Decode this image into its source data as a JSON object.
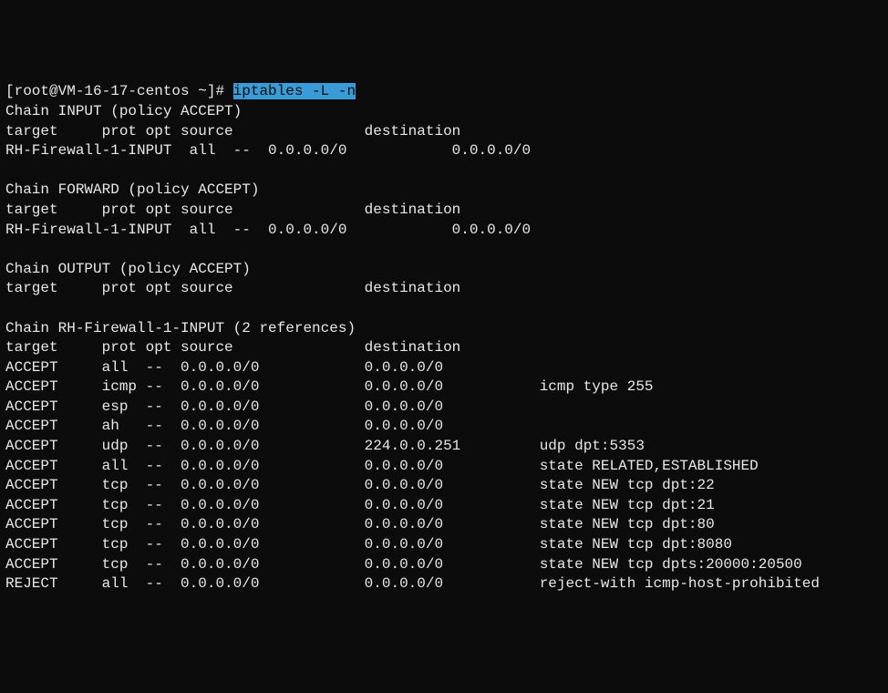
{
  "prompt": {
    "prefix": "[root@VM-16-17-centos ~]# ",
    "command": "iptables -L -n"
  },
  "chains": [
    {
      "header": "Chain INPUT (policy ACCEPT)",
      "cols": "target     prot opt source               destination",
      "rules": [
        "RH-Firewall-1-INPUT  all  --  0.0.0.0/0            0.0.0.0/0"
      ]
    },
    {
      "header": "Chain FORWARD (policy ACCEPT)",
      "cols": "target     prot opt source               destination",
      "rules": [
        "RH-Firewall-1-INPUT  all  --  0.0.0.0/0            0.0.0.0/0"
      ]
    },
    {
      "header": "Chain OUTPUT (policy ACCEPT)",
      "cols": "target     prot opt source               destination",
      "rules": []
    },
    {
      "header": "Chain RH-Firewall-1-INPUT (2 references)",
      "cols": "target     prot opt source               destination",
      "rules": [
        "ACCEPT     all  --  0.0.0.0/0            0.0.0.0/0",
        "ACCEPT     icmp --  0.0.0.0/0            0.0.0.0/0           icmp type 255",
        "ACCEPT     esp  --  0.0.0.0/0            0.0.0.0/0",
        "ACCEPT     ah   --  0.0.0.0/0            0.0.0.0/0",
        "ACCEPT     udp  --  0.0.0.0/0            224.0.0.251         udp dpt:5353",
        "ACCEPT     all  --  0.0.0.0/0            0.0.0.0/0           state RELATED,ESTABLISHED",
        "ACCEPT     tcp  --  0.0.0.0/0            0.0.0.0/0           state NEW tcp dpt:22",
        "ACCEPT     tcp  --  0.0.0.0/0            0.0.0.0/0           state NEW tcp dpt:21",
        "ACCEPT     tcp  --  0.0.0.0/0            0.0.0.0/0           state NEW tcp dpt:80",
        "ACCEPT     tcp  --  0.0.0.0/0            0.0.0.0/0           state NEW tcp dpt:8080",
        "ACCEPT     tcp  --  0.0.0.0/0            0.0.0.0/0           state NEW tcp dpts:20000:20500",
        "REJECT     all  --  0.0.0.0/0            0.0.0.0/0           reject-with icmp-host-prohibited"
      ]
    }
  ]
}
